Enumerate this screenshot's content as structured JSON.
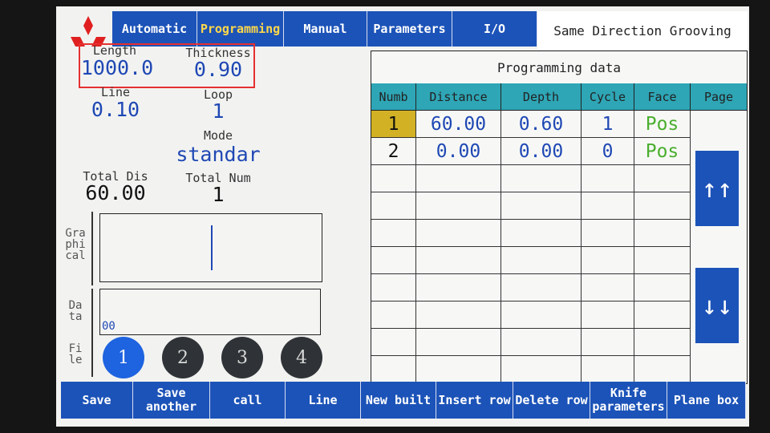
{
  "tabs": [
    {
      "label": "Automatic",
      "active": false
    },
    {
      "label": "Programming",
      "active": true
    },
    {
      "label": "Manual",
      "active": false
    },
    {
      "label": "Parameters",
      "active": false
    },
    {
      "label": "I/O",
      "active": false
    }
  ],
  "mode_title": "Same Direction Grooving",
  "fields": {
    "length": {
      "label": "Length",
      "value": "1000.0"
    },
    "thickness": {
      "label": "Thickness",
      "value": "0.90"
    },
    "line": {
      "label": "Line",
      "value": "0.10"
    },
    "loop": {
      "label": "Loop",
      "value": "1"
    },
    "mode": {
      "label": "Mode",
      "value": "standar"
    },
    "total_dis": {
      "label": "Total Dis",
      "value": "60.00"
    },
    "total_num": {
      "label": "Total Num",
      "value": "1"
    }
  },
  "graphical": {
    "label": "Gra phi cal"
  },
  "data_panel": {
    "label": "Da ta",
    "value": "00"
  },
  "file": {
    "label": "Fi le",
    "buttons": [
      "1",
      "2",
      "3",
      "4"
    ],
    "selected": "1"
  },
  "table": {
    "title": "Programming data",
    "headers": [
      "Numb",
      "Distance",
      "Depth",
      "Cycle",
      "Face"
    ],
    "page_label": "Page",
    "rows": [
      {
        "numb": "1",
        "distance": "60.00",
        "depth": "0.60",
        "cycle": "1",
        "face": "Pos"
      },
      {
        "numb": "2",
        "distance": "0.00",
        "depth": "0.00",
        "cycle": "0",
        "face": "Pos"
      }
    ],
    "page_up": "↑↑",
    "page_down": "↓↓"
  },
  "bottom_buttons": [
    "Save",
    "Save another",
    "call",
    "Line",
    "New built",
    "Insert row",
    "Delete row",
    "Knife parameters",
    "Plane box"
  ],
  "colors": {
    "tab_blue": "#1c53b8",
    "active_tab_text": "#ffd84a",
    "header_teal": "#2ea6b6",
    "highlight": "#d2b125",
    "face_green": "#4aae2e",
    "value_blue": "#1f48b4"
  }
}
